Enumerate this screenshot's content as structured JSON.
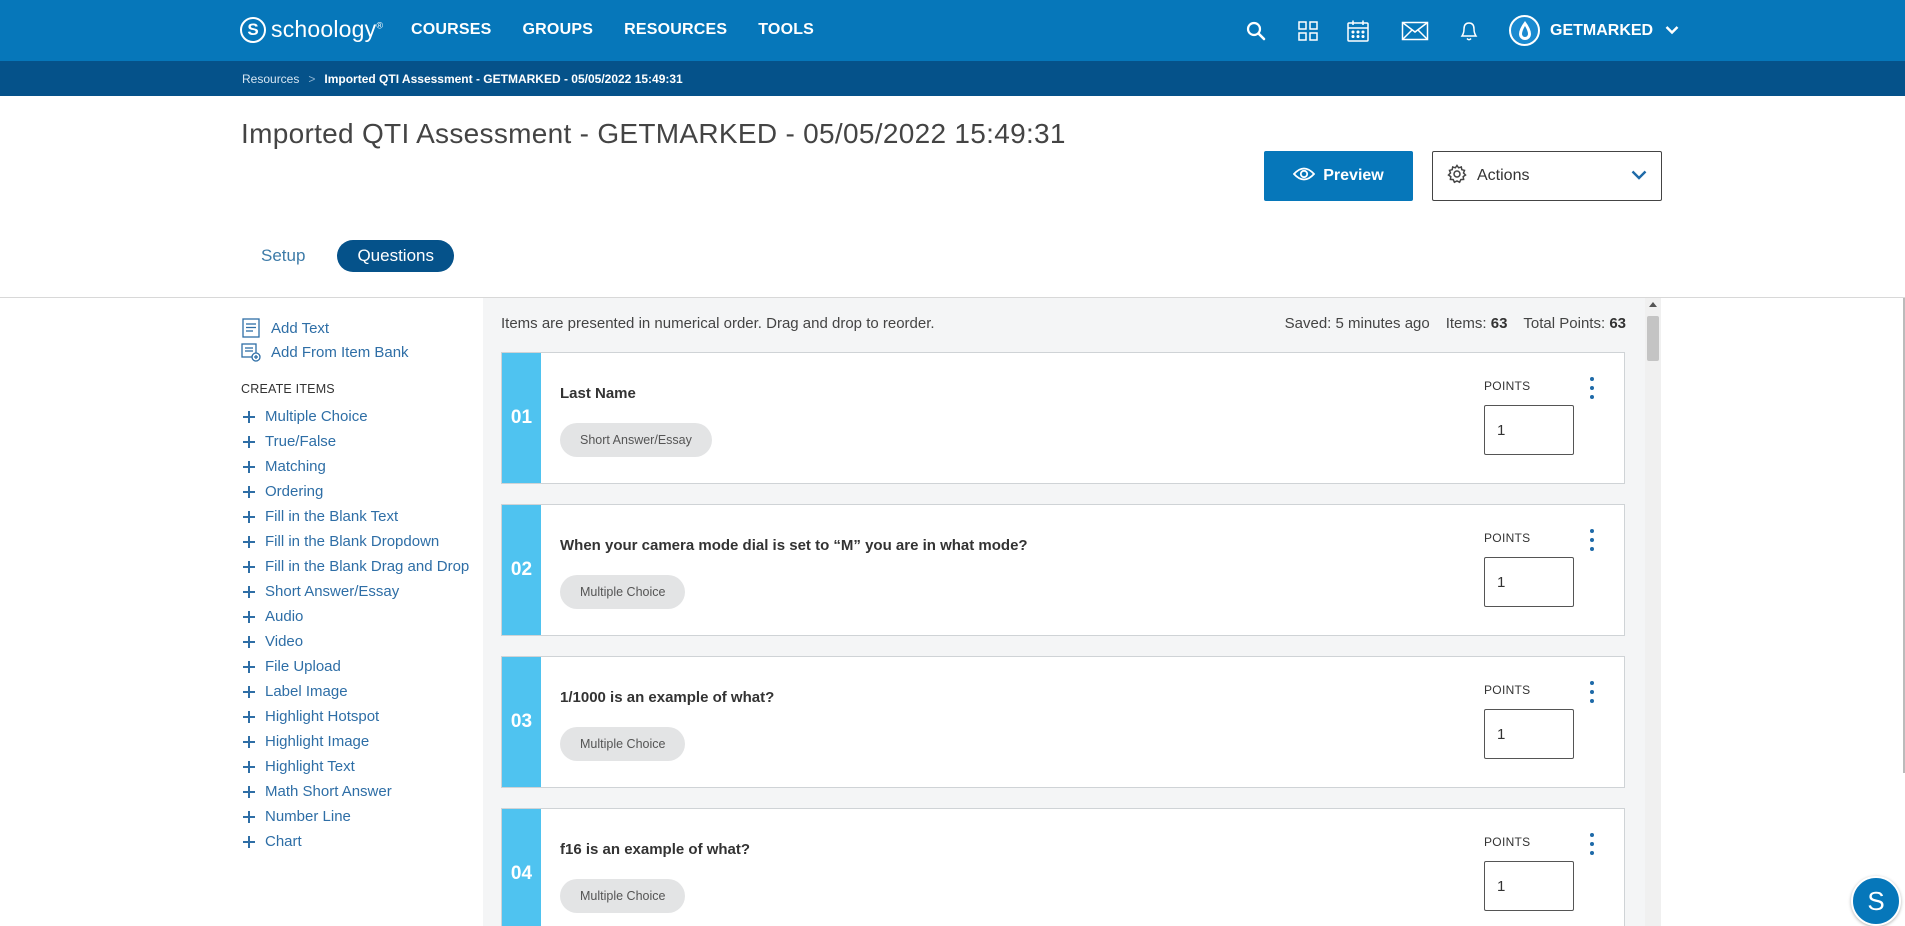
{
  "nav": {
    "logo_letter": "S",
    "logo_text": "schoology",
    "logo_mark": "®",
    "links": [
      "COURSES",
      "GROUPS",
      "RESOURCES",
      "TOOLS"
    ],
    "user_name": "GETMARKED",
    "icons": [
      "search-icon",
      "apps-grid-icon",
      "calendar-icon",
      "mail-icon",
      "notifications-bell-icon"
    ]
  },
  "breadcrumb": {
    "parent": "Resources",
    "separator": ">",
    "current": "Imported QTI Assessment - GETMARKED - 05/05/2022 15:49:31"
  },
  "header": {
    "title": "Imported QTI Assessment - GETMARKED - 05/05/2022 15:49:31",
    "preview_label": "Preview",
    "actions_label": "Actions"
  },
  "tabs": {
    "setup": "Setup",
    "questions": "Questions"
  },
  "sidebar": {
    "add_text": "Add Text",
    "add_from_bank": "Add From Item Bank",
    "create_heading": "CREATE ITEMS",
    "create_items": [
      "Multiple Choice",
      "True/False",
      "Matching",
      "Ordering",
      "Fill in the Blank Text",
      "Fill in the Blank Dropdown",
      "Fill in the Blank Drag and Drop",
      "Short Answer/Essay",
      "Audio",
      "Video",
      "File Upload",
      "Label Image",
      "Highlight Hotspot",
      "Highlight Image",
      "Highlight Text",
      "Math Short Answer",
      "Number Line",
      "Chart"
    ]
  },
  "main": {
    "instructions": "Items are presented in numerical order. Drag and drop to reorder.",
    "saved": "Saved: 5 minutes ago",
    "items_label": "Items:",
    "items_count": "63",
    "total_points_label": "Total Points:",
    "total_points": "63",
    "points_label": "POINTS",
    "questions": [
      {
        "number": "01",
        "text": "Last Name",
        "type": "Short Answer/Essay",
        "points": "1"
      },
      {
        "number": "02",
        "text": "When your camera mode dial is set to “M” you are in what mode?",
        "type": "Multiple Choice",
        "points": "1"
      },
      {
        "number": "03",
        "text": "1/1000 is an example of what?",
        "type": "Multiple Choice",
        "points": "1"
      },
      {
        "number": "04",
        "text": "f16 is an example of what?",
        "type": "Multiple Choice",
        "points": "1"
      }
    ]
  },
  "fab": {
    "label": "S"
  },
  "colors": {
    "nav_blue": "#0677ba",
    "breadcrumb_blue": "#05528a",
    "question_number_bg": "#4fc3f0",
    "link_blue": "#2e6ea6"
  }
}
